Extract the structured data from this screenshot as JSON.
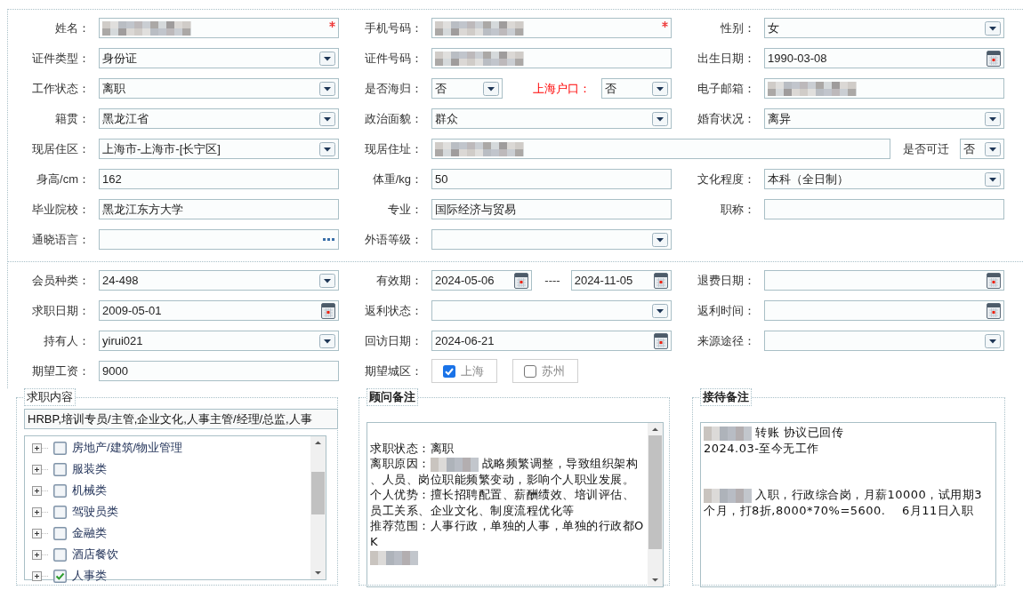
{
  "sections": [
    {
      "rows": [
        {
          "cells": [
            {
              "label": "姓名：",
              "kind": "normal",
              "controls": [
                {
                  "kind": "text",
                  "redacted": true,
                  "required": true
                }
              ]
            },
            {
              "label": "手机号码：",
              "kind": "normal",
              "controls": [
                {
                  "kind": "text",
                  "redacted": true,
                  "required": true
                }
              ]
            },
            {
              "label": "性别：",
              "kind": "normal",
              "controls": [
                {
                  "kind": "select",
                  "value": "女"
                }
              ]
            }
          ]
        },
        {
          "cells": [
            {
              "label": "证件类型：",
              "kind": "normal",
              "controls": [
                {
                  "kind": "select",
                  "value": "身份证"
                }
              ]
            },
            {
              "label": "证件号码：",
              "kind": "normal",
              "controls": [
                {
                  "kind": "text",
                  "redacted": true
                }
              ]
            },
            {
              "label": "出生日期：",
              "kind": "normal",
              "controls": [
                {
                  "kind": "date",
                  "value": "1990-03-08"
                }
              ]
            }
          ]
        },
        {
          "cells": [
            {
              "label": "工作状态：",
              "kind": "normal",
              "controls": [
                {
                  "kind": "select",
                  "value": "离职"
                }
              ]
            },
            {
              "label": "是否海归：",
              "kind": "normal",
              "controls": [
                {
                  "kind": "select",
                  "value": "否"
                },
                {
                  "kind": "label",
                  "text": "上海户口：",
                  "alert": true
                },
                {
                  "kind": "select",
                  "value": "否"
                }
              ]
            },
            {
              "label": "电子邮箱：",
              "kind": "normal",
              "controls": [
                {
                  "kind": "text",
                  "redacted": true
                }
              ]
            }
          ]
        },
        {
          "cells": [
            {
              "label": "籍贯：",
              "kind": "normal",
              "controls": [
                {
                  "kind": "select",
                  "value": "黑龙江省"
                }
              ]
            },
            {
              "label": "政治面貌：",
              "kind": "normal",
              "controls": [
                {
                  "kind": "select",
                  "value": "群众"
                }
              ]
            },
            {
              "label": "婚育状况：",
              "kind": "normal",
              "controls": [
                {
                  "kind": "select",
                  "value": "离异"
                }
              ]
            }
          ]
        },
        {
          "cells": [
            {
              "label": "现居住区：",
              "kind": "normal",
              "controls": [
                {
                  "kind": "select",
                  "value": "上海市-上海市-[长宁区]"
                }
              ]
            },
            {
              "label": "现居住址：",
              "kind": "wide",
              "controls": [
                {
                  "kind": "text",
                  "redacted": true
                },
                {
                  "kind": "label",
                  "text": "是否可迁",
                  "alert": false
                },
                {
                  "kind": "select",
                  "value": "否"
                }
              ]
            }
          ]
        },
        {
          "cells": [
            {
              "label": "身高/cm：",
              "kind": "normal",
              "controls": [
                {
                  "kind": "text",
                  "value": "162"
                }
              ]
            },
            {
              "label": "体重/kg：",
              "kind": "normal",
              "controls": [
                {
                  "kind": "text",
                  "value": "50"
                }
              ]
            },
            {
              "label": "文化程度：",
              "kind": "normal",
              "controls": [
                {
                  "kind": "select",
                  "value": "本科（全日制）"
                }
              ]
            }
          ]
        },
        {
          "cells": [
            {
              "label": "毕业院校：",
              "kind": "normal",
              "controls": [
                {
                  "kind": "text",
                  "value": "黑龙江东方大学"
                }
              ]
            },
            {
              "label": "专业：",
              "kind": "normal",
              "controls": [
                {
                  "kind": "text",
                  "value": "国际经济与贸易"
                }
              ]
            },
            {
              "label": "职称：",
              "kind": "normal",
              "controls": [
                {
                  "kind": "text"
                }
              ]
            }
          ]
        },
        {
          "cells": [
            {
              "label": "通晓语言：",
              "kind": "normal",
              "controls": [
                {
                  "kind": "picker"
                }
              ]
            },
            {
              "label": "外语等级：",
              "kind": "normal",
              "controls": [
                {
                  "kind": "select"
                }
              ]
            }
          ]
        }
      ]
    },
    {
      "rows": [
        {
          "cells": [
            {
              "label": "会员种类：",
              "kind": "normal",
              "controls": [
                {
                  "kind": "select",
                  "value": "24-498"
                }
              ]
            },
            {
              "label": "有效期：",
              "kind": "normal",
              "controls": [
                {
                  "kind": "date",
                  "value": "2024-05-06"
                },
                {
                  "kind": "label",
                  "text": "----",
                  "alert": false
                },
                {
                  "kind": "date",
                  "value": "2024-11-05"
                }
              ]
            },
            {
              "label": "退费日期：",
              "kind": "normal",
              "controls": [
                {
                  "kind": "date"
                }
              ]
            }
          ]
        },
        {
          "cells": [
            {
              "label": "求职日期：",
              "kind": "normal",
              "controls": [
                {
                  "kind": "date",
                  "value": "2009-05-01"
                }
              ]
            },
            {
              "label": "返利状态：",
              "kind": "normal",
              "controls": [
                {
                  "kind": "select"
                }
              ]
            },
            {
              "label": "返利时间：",
              "kind": "normal",
              "controls": [
                {
                  "kind": "date"
                }
              ]
            }
          ]
        },
        {
          "cells": [
            {
              "label": "持有人：",
              "kind": "normal",
              "controls": [
                {
                  "kind": "select",
                  "value": "yirui021"
                }
              ]
            },
            {
              "label": "回访日期：",
              "kind": "normal",
              "controls": [
                {
                  "kind": "date",
                  "value": "2024-06-21"
                }
              ]
            },
            {
              "label": "来源途径：",
              "kind": "normal",
              "controls": [
                {
                  "kind": "select"
                }
              ]
            }
          ]
        },
        {
          "cells": [
            {
              "label": "期望工资：",
              "kind": "normal",
              "controls": [
                {
                  "kind": "text",
                  "value": "9000"
                }
              ]
            },
            {
              "label": "期望城区：",
              "kind": "normal",
              "controls": [
                {
                  "kind": "checkbox",
                  "label": "上海",
                  "checked": true
                },
                {
                  "kind": "checkbox",
                  "label": "苏州",
                  "checked": false
                }
              ]
            }
          ]
        }
      ]
    }
  ],
  "panels": [
    {
      "kind": "tree",
      "title": "求职内容",
      "summary": "HRBP,培训专员/主管,企业文化,人事主管/经理/总监,人事",
      "items": [
        {
          "label": "房地产/建筑/物业管理",
          "checked": false,
          "expanded": false
        },
        {
          "label": "服装类",
          "checked": false,
          "expanded": false
        },
        {
          "label": "机械类",
          "checked": false,
          "expanded": false
        },
        {
          "label": "驾驶员类",
          "checked": false,
          "expanded": false
        },
        {
          "label": "金融类",
          "checked": false,
          "expanded": false
        },
        {
          "label": "酒店餐饮",
          "checked": false,
          "expanded": false
        },
        {
          "label": "人事类",
          "checked": true,
          "expanded": false
        }
      ]
    },
    {
      "kind": "notes",
      "title": "顾问备注",
      "scrollable": true,
      "lines": [
        {
          "kind": "blank"
        },
        {
          "kind": "text",
          "parts": [
            {
              "text": "求职状态：离职"
            }
          ]
        },
        {
          "kind": "text",
          "parts": [
            {
              "text": "离职原因："
            },
            {
              "redacted": true
            },
            {
              "text": "战略频繁调整，导致组织架构、人员、岗位职能频繁变动，影响个人职业发展。"
            }
          ]
        },
        {
          "kind": "text",
          "parts": [
            {
              "text": "个人优势：擅长招聘配置、薪酬绩效、培训评估、员工关系、企业文化、制度流程优化等"
            }
          ]
        },
        {
          "kind": "text",
          "parts": [
            {
              "text": "推荐范围：人事行政，单独的人事，单独的行政都OK"
            }
          ]
        },
        {
          "kind": "text",
          "parts": [
            {
              "redacted": true
            }
          ]
        }
      ]
    },
    {
      "kind": "notes",
      "title": "接待备注",
      "scrollable": false,
      "lines": [
        {
          "kind": "text",
          "parts": [
            {
              "redacted": true
            },
            {
              "text": "转账 协议已回传"
            }
          ]
        },
        {
          "kind": "text",
          "parts": [
            {
              "text": "2024.03-至今无工作"
            }
          ]
        },
        {
          "kind": "blank"
        },
        {
          "kind": "blank"
        },
        {
          "kind": "text",
          "parts": [
            {
              "redacted": true
            },
            {
              "text": "入职，行政综合岗，月薪10000，试用期3个月，打8折,8000*70%=5600.    6月11日入职"
            }
          ]
        }
      ]
    }
  ]
}
